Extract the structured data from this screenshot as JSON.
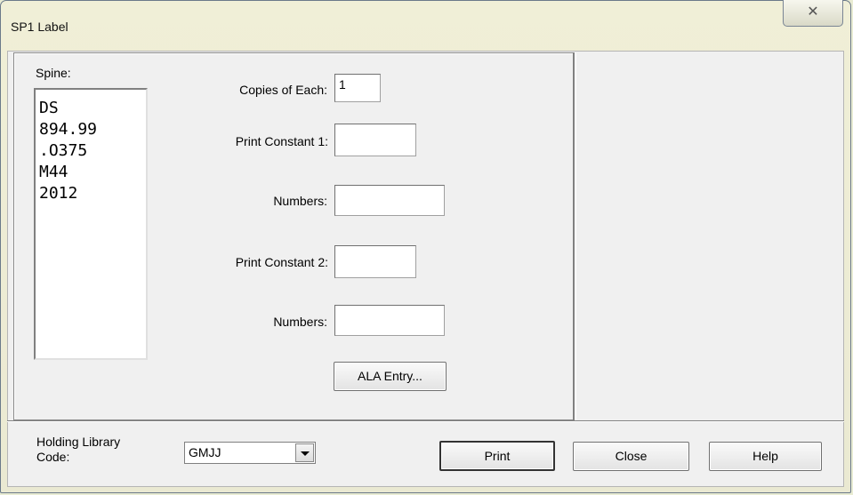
{
  "window": {
    "title": "SP1 Label",
    "close_symbol": "☒"
  },
  "spine": {
    "label": "Spine:",
    "lines": [
      "DS",
      "894.99",
      ".O375",
      "M44",
      "2012"
    ]
  },
  "form": {
    "copies_label": "Copies of Each:",
    "copies_value": "1",
    "print_constant_1_label": "Print Constant 1:",
    "print_constant_1_value": "",
    "numbers_1_label": "Numbers:",
    "numbers_1_value": "",
    "print_constant_2_label": "Print Constant 2:",
    "print_constant_2_value": "",
    "numbers_2_label": "Numbers:",
    "numbers_2_value": "",
    "ala_entry_label": "ALA Entry..."
  },
  "footer": {
    "holding_label_line1": "Holding Library",
    "holding_label_line2": "Code:",
    "holding_value": "GMJJ",
    "print_label": "Print",
    "close_label": "Close",
    "help_label": "Help"
  }
}
